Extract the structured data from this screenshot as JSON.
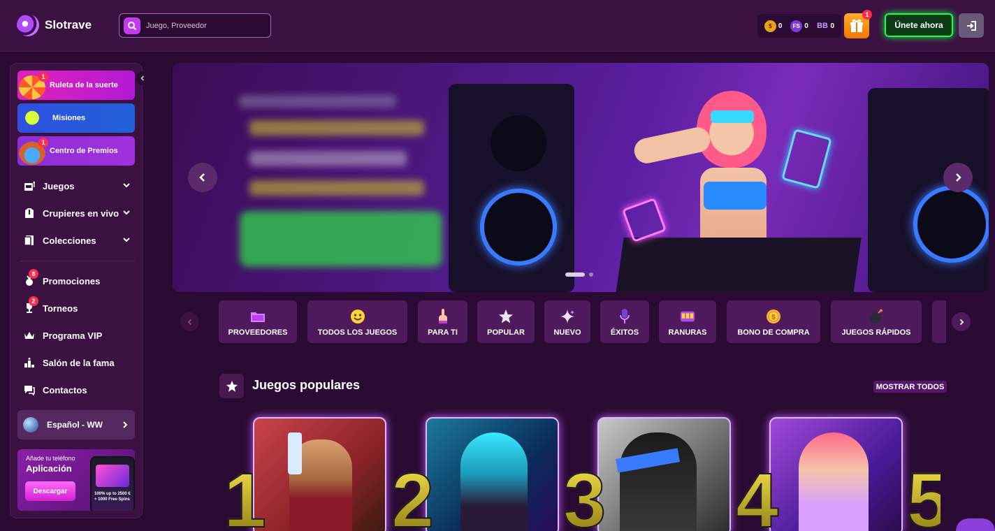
{
  "header": {
    "brand": "Slotrave",
    "search_placeholder": "Juego, Proveedor",
    "balances": [
      {
        "icon": "coin-icon",
        "value": "0"
      },
      {
        "icon": "free-spins-icon",
        "value": "0"
      },
      {
        "icon": "bonus-bb-icon",
        "value": "0"
      }
    ],
    "gift_badge": "1",
    "join_label": "Únete ahora"
  },
  "sidebar": {
    "promos": [
      {
        "label": "Ruleta de la suerte",
        "badge": "1"
      },
      {
        "label": "Misiones",
        "badge": ""
      },
      {
        "label": "Centro de Premios",
        "badge": "1"
      }
    ],
    "nav": [
      {
        "label": "Juegos"
      },
      {
        "label": "Crupieres en vivo"
      },
      {
        "label": "Colecciones"
      },
      {
        "label": "Promociones",
        "badge": "8"
      },
      {
        "label": "Torneos",
        "badge": "2"
      },
      {
        "label": "Programa VIP"
      },
      {
        "label": "Salón de la fama"
      },
      {
        "label": "Contactos"
      }
    ],
    "language": "Español - WW",
    "app": {
      "hint": "Añade tu teléfono",
      "title": "Aplicación",
      "button": "Descargar",
      "phone_caption": "100% up to 2500 € + 1000 Free Spins"
    }
  },
  "banner": {
    "slide_count": 2,
    "active_slide": 1
  },
  "categories": [
    {
      "label": "PROVEEDORES",
      "icon": "folder-icon"
    },
    {
      "label": "TODOS LOS JUEGOS",
      "icon": "smiley-icon"
    },
    {
      "label": "PARA TI",
      "icon": "pointing-hand-icon"
    },
    {
      "label": "POPULAR",
      "icon": "star-icon"
    },
    {
      "label": "NUEVO",
      "icon": "sparkle-icon"
    },
    {
      "label": "ÉXITOS",
      "icon": "microphone-icon"
    },
    {
      "label": "RANURAS",
      "icon": "slot-machine-icon"
    },
    {
      "label": "BONO DE COMPRA",
      "icon": "coin-icon"
    },
    {
      "label": "JUEGOS RÁPIDOS",
      "icon": "bomb-icon"
    }
  ],
  "popular": {
    "title": "Juegos populares",
    "show_all": "MOSTRAR TODOS",
    "ranks": [
      "1",
      "2",
      "3",
      "4",
      "5"
    ]
  },
  "colors": {
    "background": "#2a0a33",
    "panel": "#3a1141",
    "accent_green": "#1cff4a",
    "accent_purple": "#c13cf0",
    "gift_orange": "#f07800"
  }
}
